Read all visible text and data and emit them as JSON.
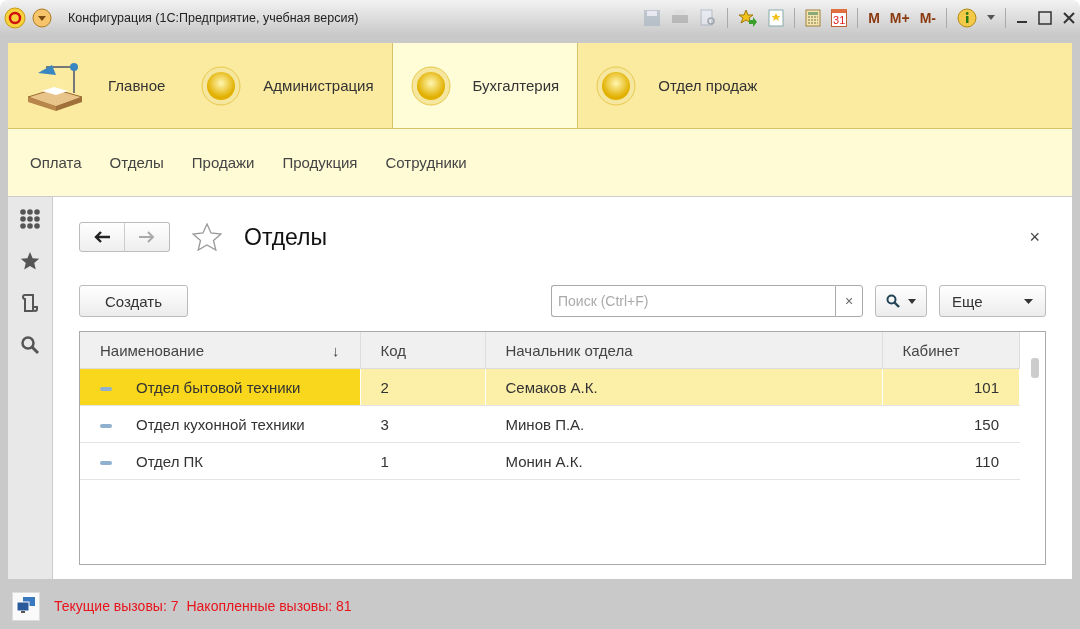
{
  "window": {
    "title": "Конфигурация  (1С:Предприятие, учебная версия)",
    "calendar_day": "31",
    "memory_buttons": [
      "M",
      "M+",
      "M-"
    ]
  },
  "sections": [
    {
      "label": "Главное",
      "kind": "home",
      "selected": false
    },
    {
      "label": "Администрация",
      "kind": "ball",
      "selected": false
    },
    {
      "label": "Бухгалтерия",
      "kind": "ball",
      "selected": true
    },
    {
      "label": "Отдел продаж",
      "kind": "ball",
      "selected": false
    }
  ],
  "subsections": [
    "Оплата",
    "Отделы",
    "Продажи",
    "Продукция",
    "Сотрудники"
  ],
  "form": {
    "title": "Отделы",
    "create_button": "Создать",
    "search": {
      "placeholder": "Поиск (Ctrl+F)"
    },
    "clear": "×",
    "more_button": "Еще",
    "close": "×"
  },
  "table": {
    "columns": [
      {
        "label": "Наименование",
        "sort": "↓"
      },
      {
        "label": "Код"
      },
      {
        "label": "Начальник отдела"
      },
      {
        "label": "Кабинет"
      }
    ],
    "rows": [
      {
        "cells": [
          "Отдел бытовой техники",
          "2",
          "Семаков А.К.",
          "101"
        ],
        "selected": true
      },
      {
        "cells": [
          "Отдел кухонной техники",
          "3",
          "Минов П.А.",
          "150"
        ],
        "selected": false
      },
      {
        "cells": [
          "Отдел ПК",
          "1",
          "Монин А.К.",
          "110"
        ],
        "selected": false
      }
    ]
  },
  "status_bar": {
    "texts": [
      "Текущие вызовы: 7",
      "Накопленные вызовы: 81"
    ]
  }
}
